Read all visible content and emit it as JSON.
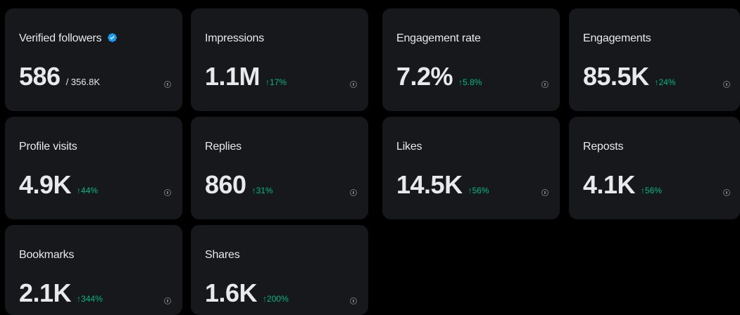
{
  "cards": [
    {
      "label": "Verified followers",
      "value": "586",
      "sub": "/ 356.8K",
      "change": ""
    },
    {
      "label": "Impressions",
      "value": "1.1M",
      "sub": "",
      "change": "↑17%"
    },
    {
      "label": "Engagement rate",
      "value": "7.2%",
      "sub": "",
      "change": "↑5.8%"
    },
    {
      "label": "Engagements",
      "value": "85.5K",
      "sub": "",
      "change": "↑24%"
    },
    {
      "label": "Profile visits",
      "value": "4.9K",
      "sub": "",
      "change": "↑44%"
    },
    {
      "label": "Replies",
      "value": "860",
      "sub": "",
      "change": "↑31%"
    },
    {
      "label": "Likes",
      "value": "14.5K",
      "sub": "",
      "change": "↑56%"
    },
    {
      "label": "Reposts",
      "value": "4.1K",
      "sub": "",
      "change": "↑56%"
    },
    {
      "label": "Bookmarks",
      "value": "2.1K",
      "sub": "",
      "change": "↑344%"
    },
    {
      "label": "Shares",
      "value": "1.6K",
      "sub": "",
      "change": "↑200%"
    }
  ],
  "colors": {
    "background": "#000000",
    "card": "#16181c",
    "text": "#e7e9ea",
    "positive": "#00ba7c",
    "muted": "#71767b",
    "verified": "#1d9bf0"
  },
  "icons": {
    "verified": "verified-badge-icon",
    "info": "info-icon"
  }
}
